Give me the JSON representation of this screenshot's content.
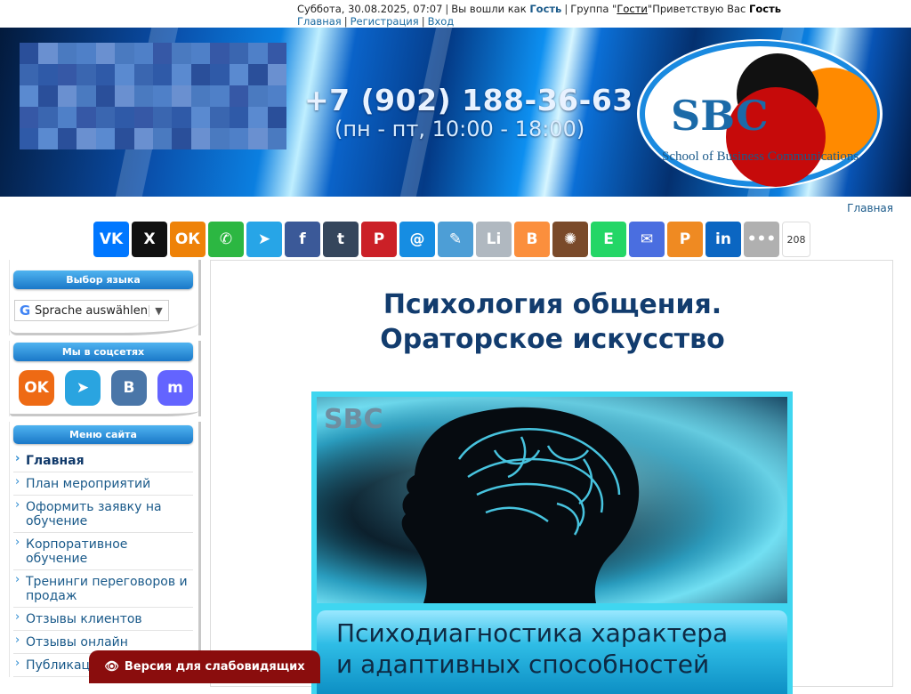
{
  "topbar": {
    "date": "Суббота, 30.08.2025, 07:07",
    "logged_as": "Вы вошли как",
    "user": "Гость",
    "group_prefix": "Группа \"",
    "group": "Гости",
    "greet": "\"Приветствую Вас",
    "greet_user": "Гость",
    "links": [
      "Главная",
      "Регистрация",
      "Вход"
    ]
  },
  "header": {
    "phone": "+7 (902) 188-36-63",
    "hours": "(пн - пт, 10:00 - 18:00)",
    "logo_text": "SBC",
    "logo_sub": "School of Business Communications"
  },
  "breadcrumb": "Главная",
  "share": {
    "count": "208",
    "buttons": [
      {
        "name": "vk",
        "label": "VK",
        "color": "#0077ff"
      },
      {
        "name": "x",
        "label": "X",
        "color": "#111111"
      },
      {
        "name": "ok",
        "label": "ОК",
        "color": "#ee8208"
      },
      {
        "name": "whatsapp",
        "label": "✆",
        "color": "#2cb742"
      },
      {
        "name": "telegram",
        "label": "➤",
        "color": "#27a5e7"
      },
      {
        "name": "facebook",
        "label": "f",
        "color": "#3b5998"
      },
      {
        "name": "tumblr",
        "label": "t",
        "color": "#35465c"
      },
      {
        "name": "pinterest",
        "label": "P",
        "color": "#cb2027"
      },
      {
        "name": "mailru",
        "label": "@",
        "color": "#168de2"
      },
      {
        "name": "livejournal",
        "label": "✎",
        "color": "#4d9ed6"
      },
      {
        "name": "liveinternet",
        "label": "Li",
        "color": "#b0b8c0"
      },
      {
        "name": "blogger",
        "label": "B",
        "color": "#fb8f3d"
      },
      {
        "name": "surfingbird",
        "label": "✺",
        "color": "#7a4a2a"
      },
      {
        "name": "evernote",
        "label": "E",
        "color": "#24d666"
      },
      {
        "name": "email",
        "label": "✉",
        "color": "#4a6ee0"
      },
      {
        "name": "pocket",
        "label": "P",
        "color": "#ef8a22"
      },
      {
        "name": "linkedin",
        "label": "in",
        "color": "#0b66c2"
      },
      {
        "name": "more",
        "label": "•••",
        "color": "#b0b0b0"
      }
    ]
  },
  "sidebar": {
    "lang_title": "Выбор языка",
    "translate": "Sprache auswählen",
    "social_title": "Мы в соцсетях",
    "socials": [
      {
        "name": "ok",
        "label": "OK",
        "color": "#ee6a14"
      },
      {
        "name": "telegram",
        "label": "➤",
        "color": "#2aa4e0"
      },
      {
        "name": "vk",
        "label": "B",
        "color": "#4a76a8"
      },
      {
        "name": "mastodon",
        "label": "m",
        "color": "#6364ff"
      }
    ],
    "menu_title": "Меню сайта",
    "menu": [
      "Главная",
      "План мероприятий",
      "Оформить заявку на обучение",
      "Корпоративное обучение",
      "Тренинги переговоров и продаж",
      "Отзывы клиентов",
      "Отзывы онлайн",
      "Публикации"
    ]
  },
  "main": {
    "title_line1": "Психология общения.",
    "title_line2": "Ораторское искусство",
    "hero_badge": "SBC",
    "hero_caption_line1": "Психодиагностика характера",
    "hero_caption_line2": "и адаптивных способностей"
  },
  "a11y_label": "Версия для слабовидящих"
}
